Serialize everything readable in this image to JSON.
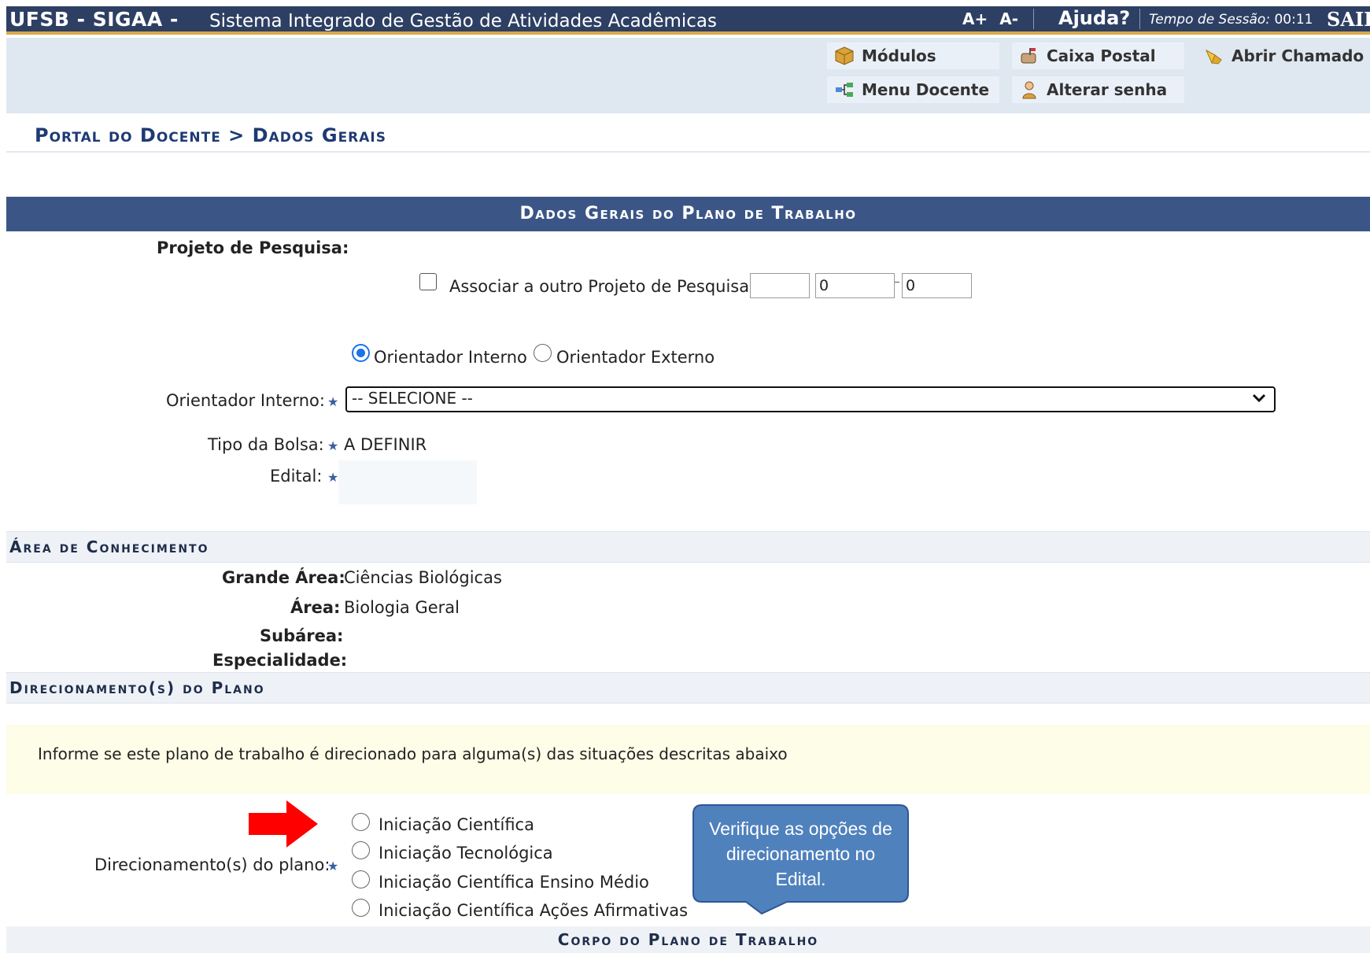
{
  "topbar": {
    "brand": "UFSB - SIGAA -",
    "system_name": "Sistema Integrado de Gestão de Atividades Acadêmicas",
    "font_increase": "A+",
    "font_decrease": "A-",
    "help": "Ajuda?",
    "session_label": "Tempo de Sessão:",
    "session_time": "00:11",
    "logout": "SAIR"
  },
  "menu": {
    "modulos": "Módulos",
    "caixa_postal": "Caixa Postal",
    "abrir_chamado": "Abrir Chamado",
    "menu_docente": "Menu Docente",
    "alterar_senha": "Alterar senha"
  },
  "breadcrumb": "Portal do Docente > Dados Gerais",
  "section_title": "Dados Gerais do Plano de Trabalho",
  "form": {
    "projeto_label": "Projeto de Pesquisa:",
    "associar_label": "Associar a outro Projeto de Pesquisa:",
    "associar_checked": false,
    "field1_value": "",
    "field2_value": "0",
    "field3_value": "0",
    "orientador_interno_option": "Orientador Interno",
    "orientador_externo_option": "Orientador Externo",
    "orientador_selected": "Orientador Interno",
    "orientador_interno_label": "Orientador Interno:",
    "orientador_select_value": "-- SELECIONE --",
    "tipo_bolsa_label": "Tipo da Bolsa:",
    "tipo_bolsa_value": "A DEFINIR",
    "edital_label": "Edital:"
  },
  "area": {
    "heading": "Área de Conhecimento",
    "grande_area_label": "Grande Área:",
    "grande_area_value": "Ciências Biológicas",
    "area_label": "Área:",
    "area_value": "Biologia Geral",
    "subarea_label": "Subárea:",
    "especialidade_label": "Especialidade:"
  },
  "direcionamento": {
    "heading": "Direcionamento(s) do Plano",
    "notice": "Informe se este plano de trabalho é direcionado para alguma(s) das situações descritas abaixo",
    "label": "Direcionamento(s) do plano:",
    "options": [
      "Iniciação Científica",
      "Iniciação Tecnológica",
      "Iniciação Científica Ensino Médio",
      "Iniciação Científica Ações Afirmativas"
    ]
  },
  "callout": {
    "line1": "Verifique as opções de",
    "line2": "direcionamento no",
    "line3": "Edital."
  },
  "corpo_heading": "Corpo do Plano de Trabalho",
  "colors": {
    "header_bg": "#2d3f63",
    "accent_border": "#d9a94a",
    "section_bg": "#3b5686",
    "callout_bg": "#4f81bd",
    "arrow": "#ff0000"
  }
}
